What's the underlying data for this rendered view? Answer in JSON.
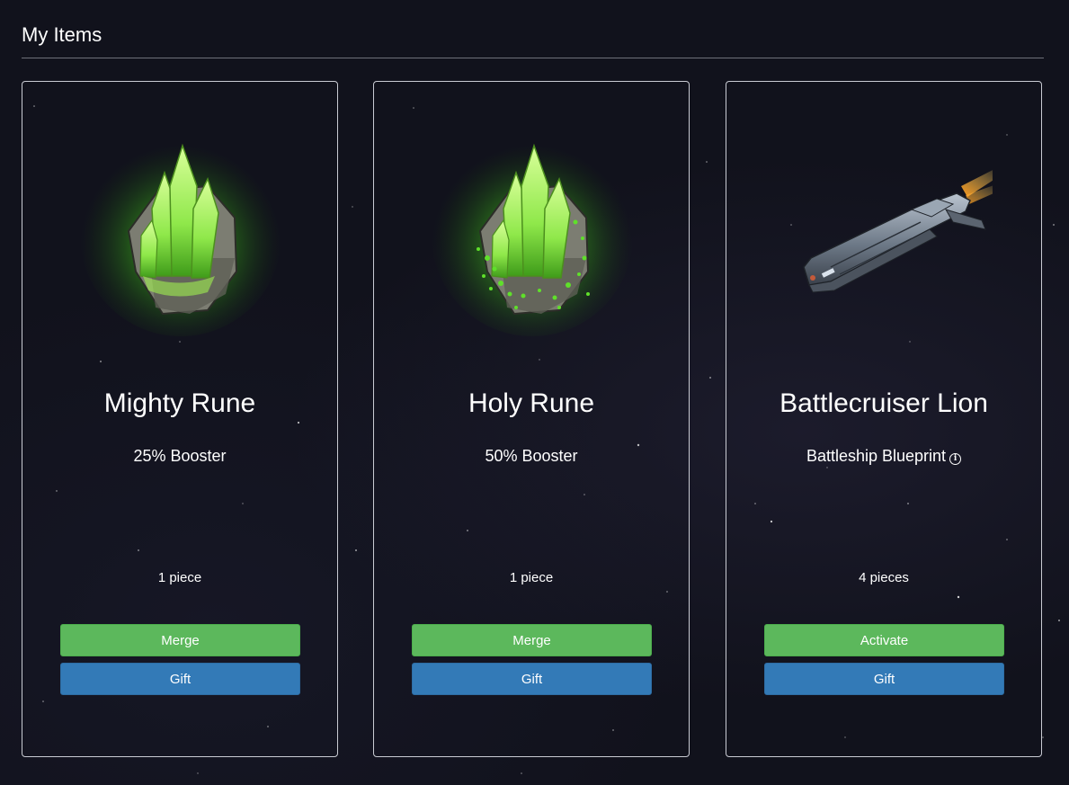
{
  "page": {
    "title": "My Items"
  },
  "items": [
    {
      "name": "Mighty Rune",
      "subtitle": "25% Booster",
      "count": "1 piece",
      "primary_action": "Merge",
      "gift_action": "Gift",
      "icon": "green-crystal-rune-icon"
    },
    {
      "name": "Holy Rune",
      "subtitle": "50% Booster",
      "count": "1 piece",
      "primary_action": "Merge",
      "gift_action": "Gift",
      "icon": "green-crystal-rune-mossy-icon"
    },
    {
      "name": "Battlecruiser Lion",
      "subtitle": "Battleship Blueprint",
      "count": "4 pieces",
      "primary_action": "Activate",
      "gift_action": "Gift",
      "icon": "battlecruiser-ship-icon"
    }
  ],
  "colors": {
    "background": "#11121c",
    "card_border": "#c9cbd3",
    "primary_button": "#5cb85c",
    "gift_button": "#337ab7",
    "rune_glow": "#7dff3a"
  }
}
